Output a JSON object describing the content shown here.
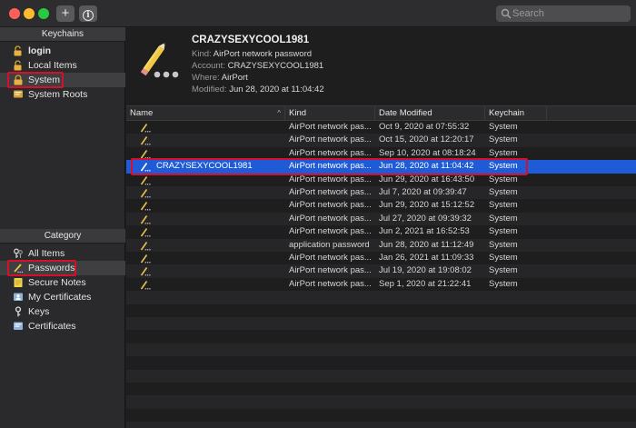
{
  "toolbar": {
    "add_label": "+",
    "info_label": "i",
    "search_placeholder": "Search"
  },
  "sidebar": {
    "keychains_header": "Keychains",
    "keychains": [
      {
        "label": "login",
        "icon": "padlock-open-icon"
      },
      {
        "label": "Local Items",
        "icon": "padlock-open-icon"
      },
      {
        "label": "System",
        "icon": "padlock-closed-icon",
        "selected": true
      },
      {
        "label": "System Roots",
        "icon": "certificate-icon"
      }
    ],
    "category_header": "Category",
    "categories": [
      {
        "label": "All Items",
        "icon": "keys-icon"
      },
      {
        "label": "Passwords",
        "icon": "pencil-icon",
        "selected": true
      },
      {
        "label": "Secure Notes",
        "icon": "note-icon"
      },
      {
        "label": "My Certificates",
        "icon": "certificate-person-icon"
      },
      {
        "label": "Keys",
        "icon": "key-icon"
      },
      {
        "label": "Certificates",
        "icon": "certificate-icon"
      }
    ]
  },
  "detail": {
    "title": "CRAZYSEXYCOOL1981",
    "kind_label": "Kind:",
    "kind": "AirPort network password",
    "account_label": "Account:",
    "account": "CRAZYSEXYCOOL1981",
    "where_label": "Where:",
    "where": "AirPort",
    "modified_label": "Modified:",
    "modified": "Jun 28, 2020 at 11:04:42"
  },
  "table": {
    "columns": {
      "name": "Name",
      "kind": "Kind",
      "date": "Date Modified",
      "keychain": "Keychain"
    },
    "rows": [
      {
        "name": "",
        "kind": "AirPort network pas...",
        "date": "Oct 9, 2020 at 07:55:32",
        "keychain": "System"
      },
      {
        "name": "",
        "kind": "AirPort network pas...",
        "date": "Oct 15, 2020 at 12:20:17",
        "keychain": "System"
      },
      {
        "name": "",
        "kind": "AirPort network pas...",
        "date": "Sep 10, 2020 at 08:18:24",
        "keychain": "System"
      },
      {
        "name": "CRAZYSEXYCOOL1981",
        "kind": "AirPort network pas...",
        "date": "Jun 28, 2020 at 11:04:42",
        "keychain": "System",
        "selected": true
      },
      {
        "name": "",
        "kind": "AirPort network pas...",
        "date": "Jun 29, 2020 at 16:43:50",
        "keychain": "System"
      },
      {
        "name": "",
        "kind": "AirPort network pas...",
        "date": "Jul 7, 2020 at 09:39:47",
        "keychain": "System"
      },
      {
        "name": "",
        "kind": "AirPort network pas...",
        "date": "Jun 29, 2020 at 15:12:52",
        "keychain": "System"
      },
      {
        "name": "",
        "kind": "AirPort network pas...",
        "date": "Jul 27, 2020 at 09:39:32",
        "keychain": "System"
      },
      {
        "name": "",
        "kind": "AirPort network pas...",
        "date": "Jun 2, 2021 at 16:52:53",
        "keychain": "System"
      },
      {
        "name": "",
        "kind": "application password",
        "date": "Jun 28, 2020 at 11:12:49",
        "keychain": "System"
      },
      {
        "name": "",
        "kind": "AirPort network pas...",
        "date": "Jan 26, 2021 at 11:09:33",
        "keychain": "System"
      },
      {
        "name": "",
        "kind": "AirPort network pas...",
        "date": "Jul 19, 2020 at 19:08:02",
        "keychain": "System"
      },
      {
        "name": "",
        "kind": "AirPort network pas...",
        "date": "Sep 1, 2020 at 21:22:41",
        "keychain": "System"
      }
    ]
  },
  "colors": {
    "selection": "#1f5bd7",
    "highlight_box": "#d6102a",
    "background": "#1e1e1e"
  }
}
